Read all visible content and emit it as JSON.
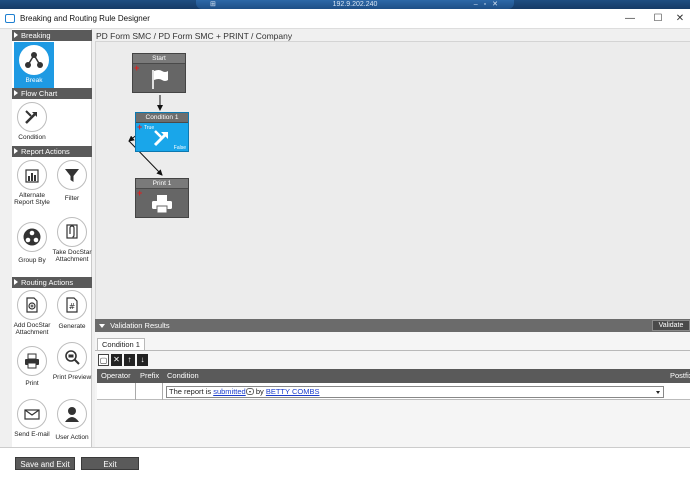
{
  "remote": {
    "address": "192.9.202.240"
  },
  "window": {
    "title": "Breaking and Routing Rule Designer"
  },
  "breadcrumb": "PD Form SMC / PD Form SMC + PRINT / Company",
  "toolbox": {
    "sections": [
      {
        "title": "Breaking",
        "tools": [
          {
            "label": "Break",
            "icon": "break-icon",
            "selected": true
          }
        ]
      },
      {
        "title": "Flow Chart",
        "tools": [
          {
            "label": "Condition",
            "icon": "condition-icon"
          }
        ]
      },
      {
        "title": "Report Actions",
        "tools": [
          {
            "label": "Alternate Report Style",
            "icon": "chart-icon"
          },
          {
            "label": "Filter",
            "icon": "filter-icon"
          },
          {
            "label": "Group By",
            "icon": "group-icon"
          },
          {
            "label": "Take DocStar Attachment",
            "icon": "attachment-icon"
          }
        ]
      },
      {
        "title": "Routing Actions",
        "tools": [
          {
            "label": "Add DocStar Attachment",
            "icon": "add-attachment-icon"
          },
          {
            "label": "Generate",
            "icon": "generate-icon"
          },
          {
            "label": "Print",
            "icon": "printer-icon"
          },
          {
            "label": "Print Preview",
            "icon": "print-preview-icon"
          },
          {
            "label": "Send E-mail",
            "icon": "email-icon"
          },
          {
            "label": "User Action",
            "icon": "user-icon"
          }
        ]
      }
    ]
  },
  "flow": {
    "nodes": [
      {
        "title": "Start",
        "icon": "flag-icon"
      },
      {
        "title": "Condition 1",
        "icon": "condition-icon",
        "true_label": "True",
        "false_label": "False"
      },
      {
        "title": "Print 1",
        "icon": "printer-icon"
      }
    ]
  },
  "validation": {
    "header": "Validation Results",
    "validate_label": "Validate",
    "tab": "Condition 1",
    "columns": [
      "Operator",
      "Prefix",
      "Condition",
      "Postfix"
    ],
    "row": {
      "text_before": "The report is",
      "link1": "submitted",
      "text_mid": "by",
      "link2": "BETTY COMBS"
    }
  },
  "footer": {
    "save_exit": "Save and Exit",
    "exit": "Exit"
  },
  "colors": {
    "accent": "#1e9ae3",
    "header": "#5a5a5a",
    "link": "#1a3ccc"
  }
}
